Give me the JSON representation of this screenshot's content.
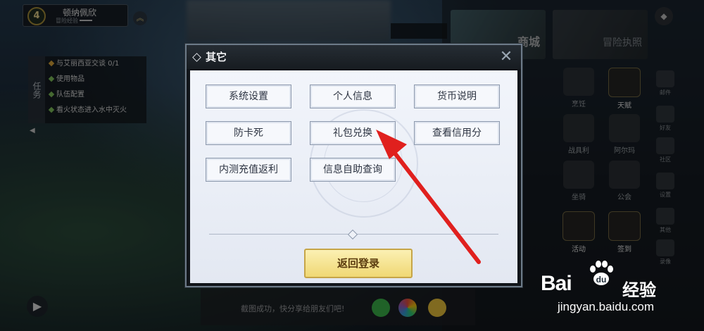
{
  "player": {
    "level": "4",
    "name": "顿纳佩欣",
    "exp_label": "冒险经验"
  },
  "tasks": {
    "tab_label": "任务",
    "items": [
      {
        "text": "与艾丽西亚交谈 0/1"
      },
      {
        "text": "使用物品"
      },
      {
        "text": "队伍配置"
      },
      {
        "text": "看火状态进入水中灭火"
      }
    ]
  },
  "right_menu": {
    "shop": "商城",
    "adventure": "冒险执照",
    "icons": [
      "烹饪",
      "天赋",
      "战具利",
      "阿尔玛",
      "坐骑",
      "公会",
      "活动",
      "签到"
    ],
    "side": [
      "邮件",
      "好友",
      "社区",
      "设置",
      "其他",
      "录像"
    ]
  },
  "modal": {
    "title": "其它",
    "buttons": [
      "系统设置",
      "个人信息",
      "货币说明",
      "防卡死",
      "礼包兑换",
      "查看信用分",
      "内测充值返利",
      "信息自助查询"
    ],
    "return_label": "返回登录"
  },
  "chat": {
    "text": "截图成功，快分享给朋友们吧!"
  },
  "watermark": {
    "logo": "Bai",
    "logo_cn": "经验",
    "url": "jingyan.baidu.com"
  },
  "colors": {
    "arrow": "#e0201e",
    "return_button": "#f0d874"
  }
}
